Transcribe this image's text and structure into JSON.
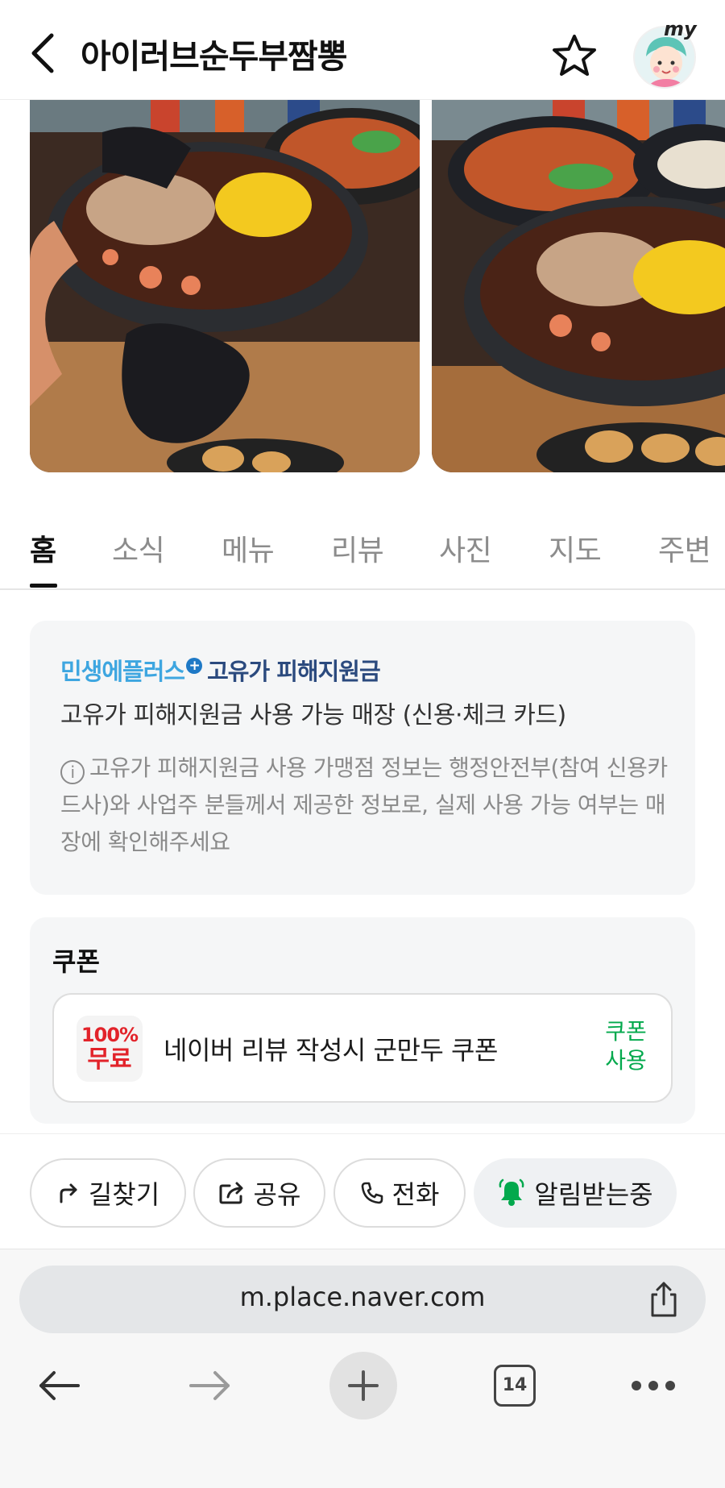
{
  "header": {
    "title": "아이러브순두부짬뽕",
    "my_label": "my"
  },
  "tabs": [
    "홈",
    "소식",
    "메뉴",
    "리뷰",
    "사진",
    "지도",
    "주변"
  ],
  "info_card": {
    "brand_a": "민생에플러스",
    "brand_plus": "+",
    "brand_b": "고유가 피해지원금",
    "subtitle": "고유가 피해지원금 사용 가능 매장 (신용·체크 카드)",
    "note": "고유가 피해지원금 사용 가맹점 정보는 행정안전부(참여 신용카드사)와 사업주 분들께서 제공한 정보로, 실제 사용 가능 여부는 매장에 확인해주세요",
    "info_icon": "i"
  },
  "coupon": {
    "section_title": "쿠폰",
    "logo_line1": "100%",
    "logo_line2": "무료",
    "text": "네이버 리뷰 작성시 군만두 쿠폰",
    "use_label_1": "쿠폰",
    "use_label_2": "사용"
  },
  "actions": {
    "directions": "길찾기",
    "share": "공유",
    "call": "전화",
    "alerts": "알림받는중"
  },
  "browser": {
    "url": "m.place.naver.com",
    "tab_count": "14"
  },
  "colors": {
    "accent_green": "#03a94d",
    "brand_blue": "#3ea6e0",
    "brand_navy": "#2b4a7e",
    "coupon_red": "#e2232a"
  }
}
